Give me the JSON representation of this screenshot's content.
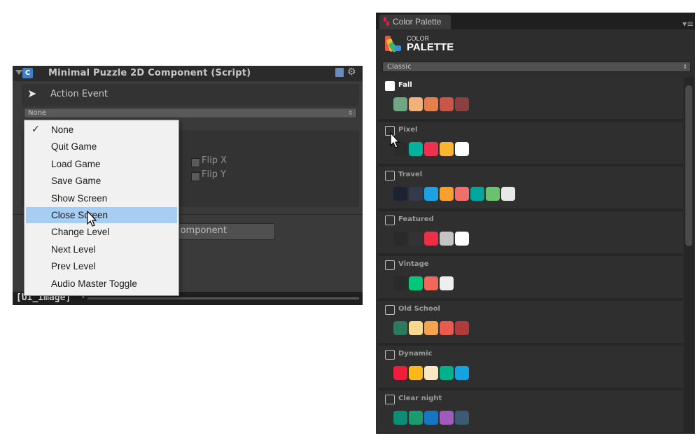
{
  "inspector": {
    "title": "Minimal Puzzle 2D Component (Script)",
    "action_event_label": "Action Event",
    "action_select_value": "None",
    "flip_x_label": "Flip X",
    "flip_y_label": "Flip Y",
    "add_component_label": "omponent",
    "footer_name": "[UI_Image]"
  },
  "dropdown": {
    "items": [
      {
        "label": "None",
        "checked": true,
        "highlighted": false
      },
      {
        "label": "Quit Game",
        "checked": false,
        "highlighted": false
      },
      {
        "label": "Load Game",
        "checked": false,
        "highlighted": false
      },
      {
        "label": "Save Game",
        "checked": false,
        "highlighted": false
      },
      {
        "label": "Show Screen",
        "checked": false,
        "highlighted": false
      },
      {
        "label": "Close Screen",
        "checked": false,
        "highlighted": true
      },
      {
        "label": "Change Level",
        "checked": false,
        "highlighted": false
      },
      {
        "label": "Next Level",
        "checked": false,
        "highlighted": false
      },
      {
        "label": "Prev Level",
        "checked": false,
        "highlighted": false
      },
      {
        "label": "Audio Master Toggle",
        "checked": false,
        "highlighted": false
      }
    ]
  },
  "palette_window": {
    "tab_title": "Color Palette",
    "logo_top": "COLOR",
    "logo_main": "PALETTE",
    "select_value": "Classic",
    "palettes": [
      {
        "name": "Fall",
        "checked": true,
        "colors": [
          "#6fa784",
          "#f0b27a",
          "#e67e4d",
          "#c9564a",
          "#8c4040"
        ]
      },
      {
        "name": "Pixel",
        "checked": false,
        "colors": [
          "#2b2b2b",
          "#00b39a",
          "#ee3150",
          "#f9b52f",
          "#ffffff"
        ]
      },
      {
        "name": "Travel",
        "checked": false,
        "colors": [
          "#1c2230",
          "#343a4e",
          "#1da1e2",
          "#f7a02f",
          "#ef6f6c",
          "#00a59b",
          "#6cc16e",
          "#e8e8e8"
        ]
      },
      {
        "name": "Featured",
        "checked": false,
        "colors": [
          "#2a2a2a",
          "#333333",
          "#ef2d46",
          "#c4c4c4",
          "#ffffff"
        ]
      },
      {
        "name": "Vintage",
        "checked": false,
        "colors": [
          "#2a2a2a",
          "#00c77a",
          "#f0675c",
          "#eeeeee"
        ]
      },
      {
        "name": "Old School",
        "checked": false,
        "colors": [
          "#2c7a5d",
          "#f6d98c",
          "#f4a450",
          "#ea5a4e",
          "#b03b3a"
        ]
      },
      {
        "name": "Dynamic",
        "checked": false,
        "colors": [
          "#ee1d3b",
          "#fbb817",
          "#fce7c3",
          "#00b28a",
          "#14a2e0"
        ]
      },
      {
        "name": "Clear night",
        "checked": false,
        "colors": [
          "#0d8c78",
          "#1a9a6e",
          "#1576c4",
          "#a15bbd",
          "#3c5a73"
        ]
      }
    ]
  }
}
